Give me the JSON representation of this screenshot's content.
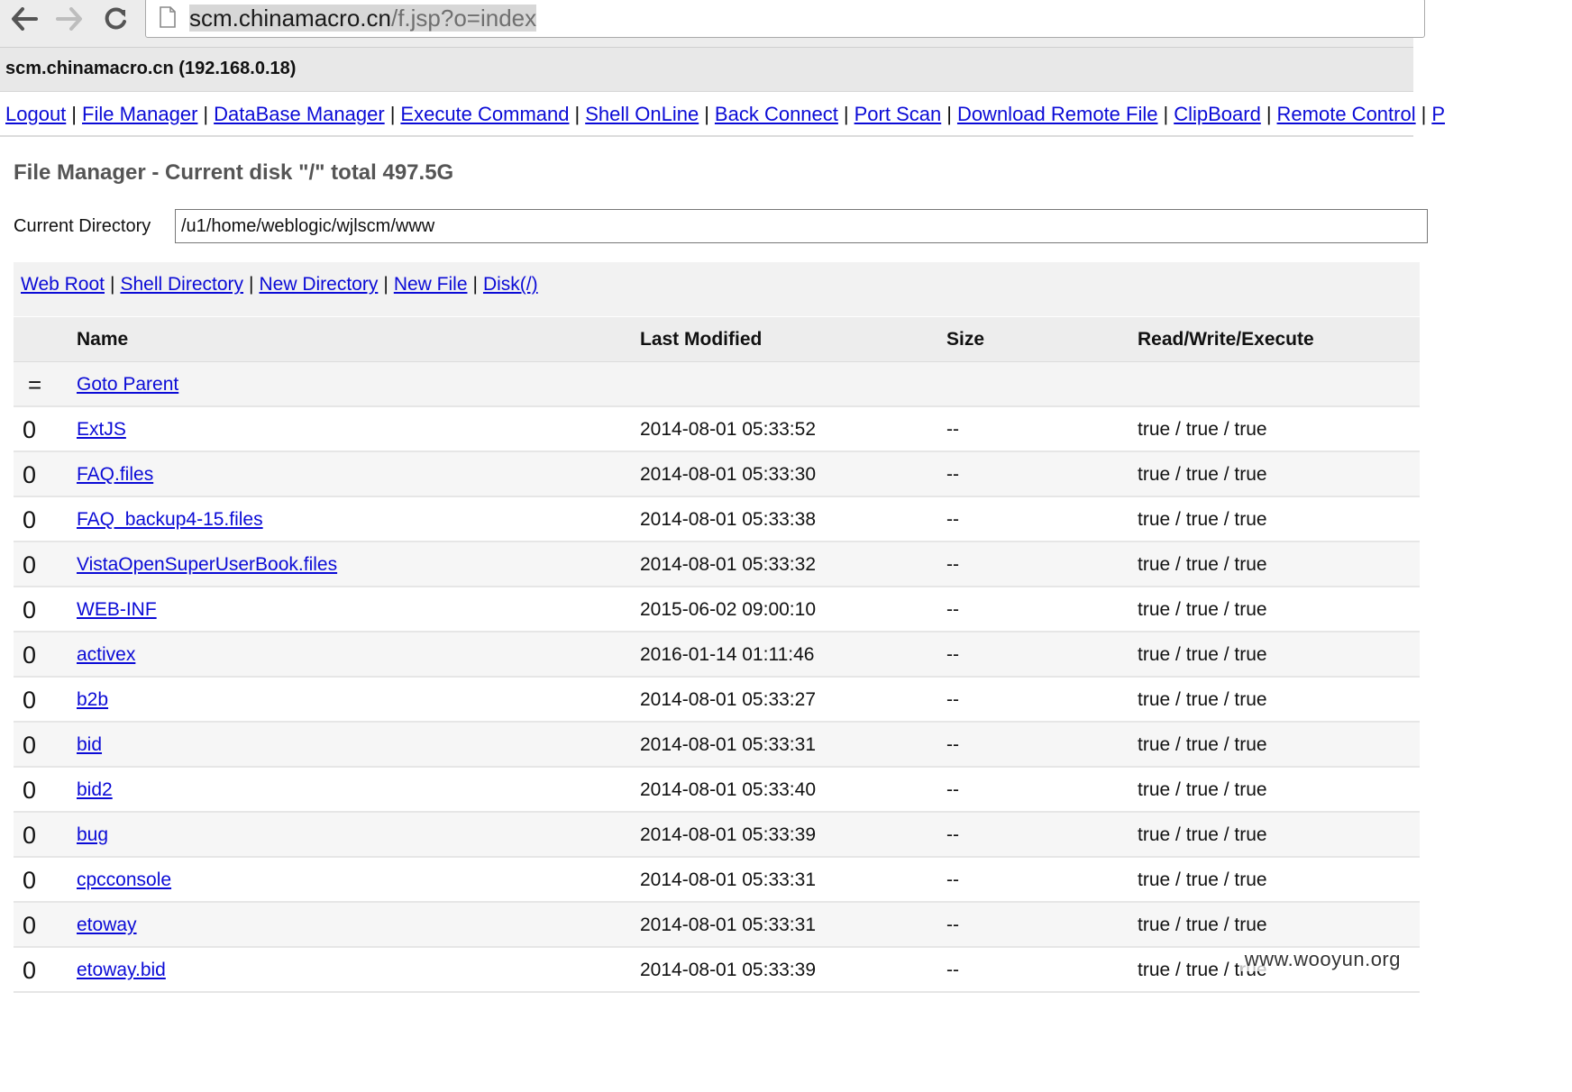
{
  "browser": {
    "url_host": "scm.chinamacro.cn",
    "url_path": "/f.jsp?o=index"
  },
  "host_title": "scm.chinamacro.cn (192.168.0.18)",
  "menu": [
    "Logout",
    "File Manager",
    "DataBase Manager",
    "Execute Command",
    "Shell OnLine",
    "Back Connect",
    "Port Scan",
    "Download Remote File",
    "ClipBoard",
    "Remote Control",
    "P"
  ],
  "menu_separator": "|",
  "heading": "File Manager - Current disk \"/\" total 497.5G",
  "current_directory": {
    "label": "Current Directory",
    "value": "/u1/home/weblogic/wjlscm/www"
  },
  "quick_links": [
    "Web Root",
    "Shell Directory",
    "New Directory",
    "New File",
    "Disk(/)"
  ],
  "table": {
    "columns": [
      "Name",
      "Last Modified",
      "Size",
      "Read/Write/Execute"
    ],
    "parent": {
      "icon": "=",
      "label": "Goto Parent"
    },
    "rows": [
      {
        "icon": "0",
        "name": "ExtJS",
        "modified": "2014-08-01 05:33:52",
        "size": "--",
        "rwx": "true / true / true"
      },
      {
        "icon": "0",
        "name": "FAQ.files",
        "modified": "2014-08-01 05:33:30",
        "size": "--",
        "rwx": "true / true / true"
      },
      {
        "icon": "0",
        "name": "FAQ_backup4-15.files",
        "modified": "2014-08-01 05:33:38",
        "size": "--",
        "rwx": "true / true / true"
      },
      {
        "icon": "0",
        "name": "VistaOpenSuperUserBook.files",
        "modified": "2014-08-01 05:33:32",
        "size": "--",
        "rwx": "true / true / true"
      },
      {
        "icon": "0",
        "name": "WEB-INF",
        "modified": "2015-06-02 09:00:10",
        "size": "--",
        "rwx": "true / true / true"
      },
      {
        "icon": "0",
        "name": "activex",
        "modified": "2016-01-14 01:11:46",
        "size": "--",
        "rwx": "true / true / true"
      },
      {
        "icon": "0",
        "name": "b2b",
        "modified": "2014-08-01 05:33:27",
        "size": "--",
        "rwx": "true / true / true"
      },
      {
        "icon": "0",
        "name": "bid",
        "modified": "2014-08-01 05:33:31",
        "size": "--",
        "rwx": "true / true / true"
      },
      {
        "icon": "0",
        "name": "bid2",
        "modified": "2014-08-01 05:33:40",
        "size": "--",
        "rwx": "true / true / true"
      },
      {
        "icon": "0",
        "name": "bug",
        "modified": "2014-08-01 05:33:39",
        "size": "--",
        "rwx": "true / true / true"
      },
      {
        "icon": "0",
        "name": "cpcconsole",
        "modified": "2014-08-01 05:33:31",
        "size": "--",
        "rwx": "true / true / true"
      },
      {
        "icon": "0",
        "name": "etoway",
        "modified": "2014-08-01 05:33:31",
        "size": "--",
        "rwx": "true / true / true"
      },
      {
        "icon": "0",
        "name": "etoway.bid",
        "modified": "2014-08-01 05:33:39",
        "size": "--",
        "rwx": "true / true / true"
      }
    ]
  },
  "watermark": "www.wooyun.org"
}
